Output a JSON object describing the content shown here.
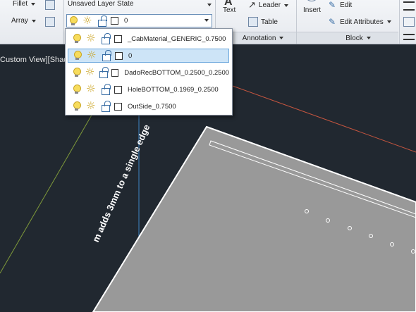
{
  "ribbon": {
    "fillet_label": "Fillet",
    "array_label": "Array",
    "layer_state": "Unsaved Layer State",
    "current_layer": "0",
    "text_label": "Text",
    "leader_label": "Leader",
    "table_label": "Table",
    "annotation_panel": "Annotation",
    "insert_label": "Insert",
    "edit_label": "Edit",
    "edit_attributes_label": "Edit Attributes",
    "block_panel": "Block"
  },
  "layer_list": [
    {
      "name": "_CabMaterial_GENERIC_0.7500",
      "selected": false
    },
    {
      "name": "0",
      "selected": true
    },
    {
      "name": "DadoRecBOTTOM_0.2500_0.2500",
      "selected": false
    },
    {
      "name": "HoleBOTTOM_0.1969_0.2500",
      "selected": false
    },
    {
      "name": "OutSide_0.7500",
      "selected": false
    }
  ],
  "viewport": {
    "label": "Custom View][Shad",
    "rotated_text": "m adds 3mm to a single edge"
  },
  "colors": {
    "canvas": "#212830",
    "part_face": "#999999",
    "selection": "#cde4f7"
  }
}
